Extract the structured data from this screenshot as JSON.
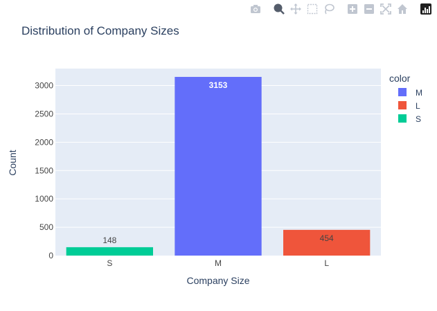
{
  "colors": {
    "plot_bg": "#e5ecf6",
    "grid": "#ffffff",
    "text": "#2a3f5f",
    "tick_text": "#444444",
    "modebar_icon": "#c0c6d0",
    "modebar_active": "#4e5766"
  },
  "modebar": {
    "icons": [
      "camera-icon",
      "zoom-icon",
      "pan-icon",
      "box-select-icon",
      "lasso-icon",
      "zoom-in-icon",
      "zoom-out-icon",
      "autoscale-icon",
      "home-icon",
      "plotly-logo-icon"
    ]
  },
  "chart_data": {
    "type": "bar",
    "title": "Distribution of Company Sizes",
    "xlabel": "Company Size",
    "ylabel": "Count",
    "categories": [
      "S",
      "M",
      "L"
    ],
    "ylim": [
      0,
      3300
    ],
    "yticks": [
      0,
      500,
      1000,
      1500,
      2000,
      2500,
      3000
    ],
    "grid": true,
    "legend": {
      "title": "color",
      "placement": "top-right",
      "entries": [
        "M",
        "L",
        "S"
      ]
    },
    "series": [
      {
        "name": "M",
        "color": "#636efa",
        "categories": [
          "M"
        ],
        "values": [
          3153
        ]
      },
      {
        "name": "L",
        "color": "#ef553b",
        "categories": [
          "L"
        ],
        "values": [
          454
        ]
      },
      {
        "name": "S",
        "color": "#00cc96",
        "categories": [
          "S"
        ],
        "values": [
          148
        ]
      }
    ]
  }
}
